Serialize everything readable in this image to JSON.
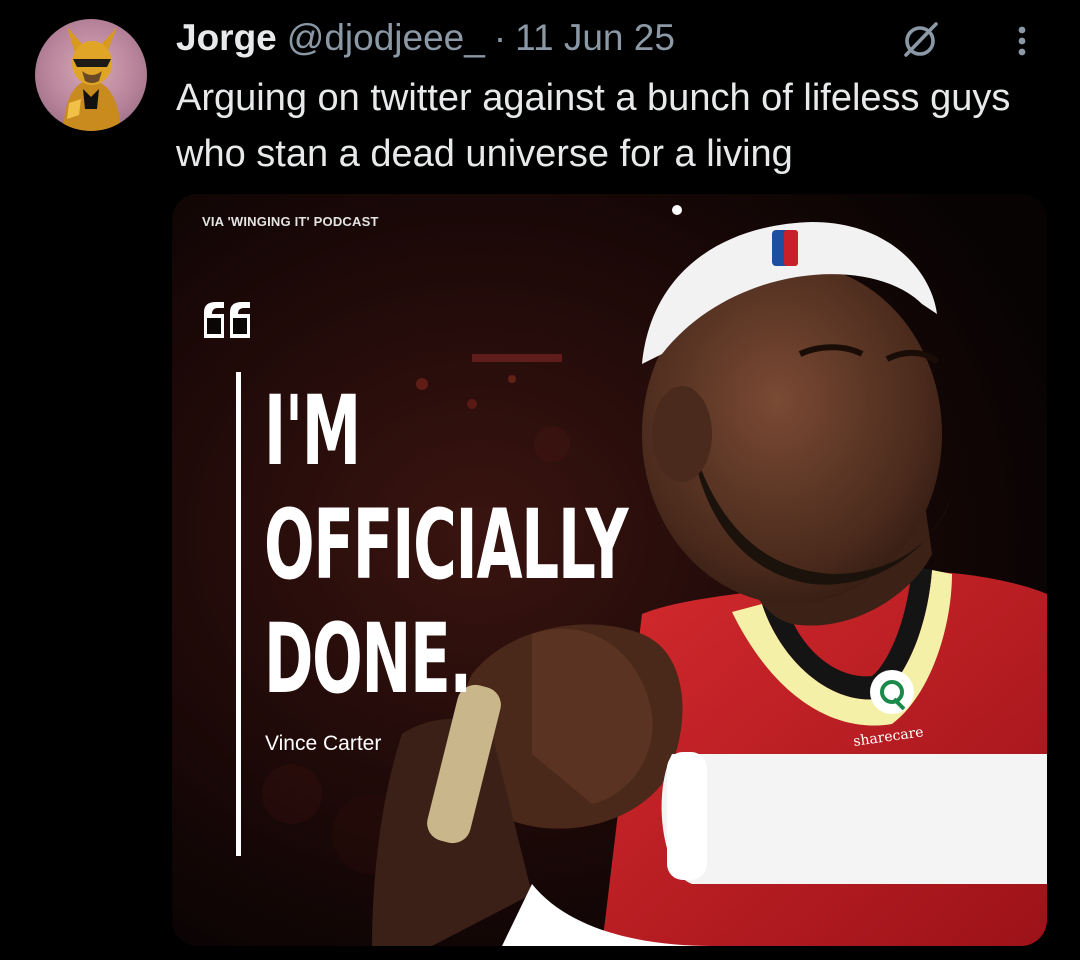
{
  "post": {
    "author_name": "Jorge",
    "handle": "@djodjeee_",
    "separator": "·",
    "date": "11 Jun 25",
    "text": "Arguing on twitter against a bunch of lifeless guys who stan a dead universe for a living",
    "icons": {
      "avatar": "superhero-avatar",
      "grok": "grok-icon",
      "more": "more-vertical-icon"
    }
  },
  "media": {
    "via": "VIA 'WINGING IT' PODCAST",
    "headline": [
      "I'M",
      "OFFICIALLY",
      "DONE."
    ],
    "speaker": "Vince Carter",
    "jersey_sponsor": "sharecare",
    "colors": {
      "background": "#0a0606",
      "jersey": "#c8202a",
      "jersey_trim": "#d8d820",
      "headband": "#f2f2f2"
    }
  }
}
